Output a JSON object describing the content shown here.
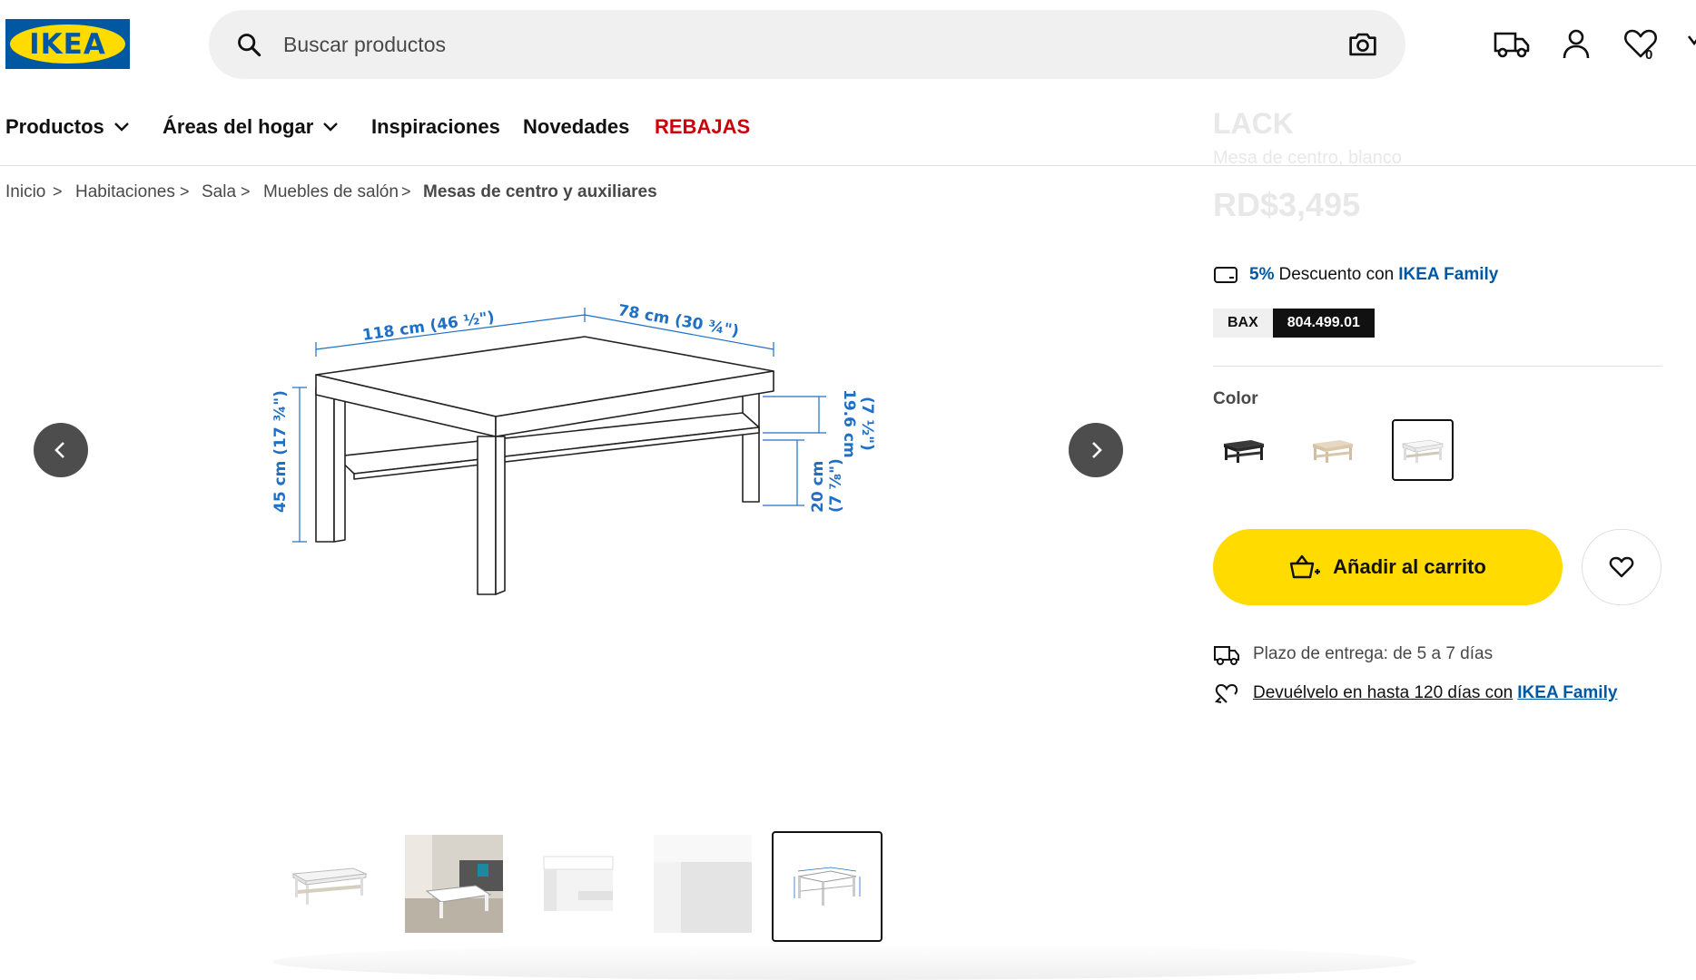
{
  "header": {
    "logo_text": "IKEA",
    "search_placeholder": "Buscar productos",
    "wishlist_count": "0"
  },
  "nav": {
    "items": [
      {
        "label": "Productos"
      },
      {
        "label": "Áreas del hogar"
      },
      {
        "label": "Inspiraciones"
      },
      {
        "label": "Novedades"
      },
      {
        "label": "REBAJAS"
      }
    ]
  },
  "breadcrumb": {
    "items": [
      "Inicio",
      "Habitaciones",
      "Sala",
      "Muebles de salón",
      "Mesas de centro y auxiliares"
    ],
    "separator": ">"
  },
  "sticky_title": {
    "name": "LACK",
    "description": "Mesa de centro, blanco",
    "price": "RD$3,495"
  },
  "product": {
    "family_discount_pct": "5%",
    "family_discount_text": "Descuento con",
    "family_brand": "IKEA Family",
    "article_label": "BAX",
    "article_number": "804.499.01",
    "color_label": "Color",
    "add_to_cart": "Añadir al carrito",
    "delivery_text": "Plazo de entrega: de 5 a 7 días",
    "return_text": "Devuélvelo en hasta 120 días con",
    "return_brand": "IKEA Family"
  },
  "dimensions": {
    "width": "118 cm (46 ½\")",
    "depth": "78 cm (30 ¾\")",
    "height": "45 cm (17 ¾\")",
    "shelf_gap": "19.6 cm",
    "shelf_gap_in": "(7 ½\")",
    "shelf_height": "20 cm",
    "shelf_height_in": "(7 ⅞\")"
  },
  "colors": {
    "accent_yellow": "#ffdb00",
    "brand_blue": "#0058a3",
    "sale_red": "#cc0008",
    "dimension_blue": "#1f6fc5"
  }
}
